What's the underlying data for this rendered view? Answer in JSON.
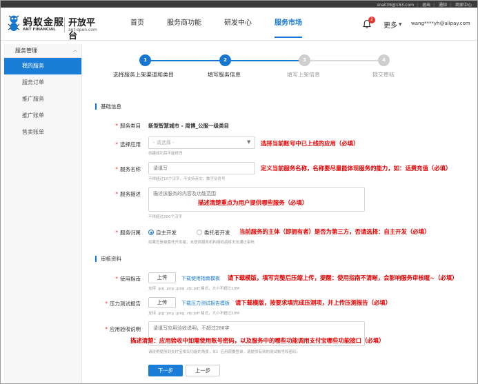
{
  "topbar": {
    "account_email": "snail39@163.com",
    "links": [
      "退出",
      "通知",
      "商家中心"
    ]
  },
  "header": {
    "brand_cn": "蚂蚁金服",
    "brand_en": "ANT FINANCIAL",
    "platform_cn": "开放平台",
    "platform_en": "ant-open.com",
    "nav": [
      "首页",
      "服务商功能",
      "研发中心",
      "服务市场"
    ],
    "active_nav": "服务市场",
    "notification_count": "2",
    "more_label": "更多",
    "user_account": "wang****yh@alipay.com"
  },
  "sidebar": {
    "group_title": "服务管理",
    "items": [
      "我的服务",
      "服务订单",
      "推广服务",
      "推广账单",
      "售卖账单"
    ],
    "active_item": "我的服务"
  },
  "steps": [
    {
      "num": "1",
      "label": "选择服务上架渠道和类目",
      "state": "done"
    },
    {
      "num": "2",
      "label": "填写服务信息",
      "state": "active"
    },
    {
      "num": "3",
      "label": "填写上架信息",
      "state": "todo"
    },
    {
      "num": "4",
      "label": "提交审核",
      "state": "todo"
    }
  ],
  "colors": {
    "accent": "#1677d2",
    "annotation": "#e60000",
    "required": "#e23b2e"
  },
  "basic": {
    "section_title": "基础信息",
    "category_label": "服务类目",
    "category_value": "新型智慧城市 - 周博_公服一级类目",
    "app_label": "选择应用",
    "app_placeholder": "- 请选择 -",
    "app_hint": "创建成功后不能修改",
    "app_anno": "选择当前账号中已上线的应用（必填）",
    "name_label": "服务名称",
    "name_placeholder": "请填写",
    "name_hint": "不得超过10个汉字，不支持英文、数字及符号",
    "name_anno": "定义当前服务名称，名称要尽量能体现服务的能力，如：话费充值（必填）",
    "desc_label": "服务描述",
    "desc_placeholder": "描述该服务的内容及功能范围",
    "desc_anno": "描述清楚重点为用户提供哪些服务（必填）",
    "desc_hint": "不得超过200个汉字",
    "owner_label": "服务归属",
    "owner_opt1": "自主开发",
    "owner_opt2": "委托者开发",
    "owner_anno": "当前服务的主体（即拥有者）是否为第三方，否请选择：自主开发（必填）",
    "owner_hint": "如果您是被委托开发者，未提供服务机构授权函将无法通过审核"
  },
  "audit": {
    "section_title": "审核资料",
    "guide_label": "使用指南",
    "guide_btn": "上传",
    "guide_link": "下载使用指南模板",
    "guide_anno": "请下载模版，填写完整后压缩上传，提醒：使用指南不清晰，会影响服务审核喔~（必填）",
    "guide_hint": "支持 .jpg .png .jpeg .zip.pdf 格式，大小不超过10M",
    "stress_label": "压力测试报告",
    "stress_btn": "上传",
    "stress_link": "下载压力测试报告模板",
    "stress_anno": "请下载模版，按要求填完成压测项，并上传压测报告（必填）",
    "stress_hint": "支持 .jpg .png .jpeg .zip.pdf 格式，大小不超过10M",
    "accept_label": "应用验收说明",
    "accept_placeholder": "请填写应用验收说明，不超过200字",
    "accept_anno": "描述清楚：应用验收中如需使用账号密码，以及服务中的哪些功能调用支付宝哪些功能接口（必填）",
    "accept_hint": "请说明使用到支付宝相关功能的场景，如：应用需要登录，请提供有效的测试帐号和密码。"
  },
  "footer": {
    "next_label": "下一步",
    "prev_label": "上一步"
  }
}
